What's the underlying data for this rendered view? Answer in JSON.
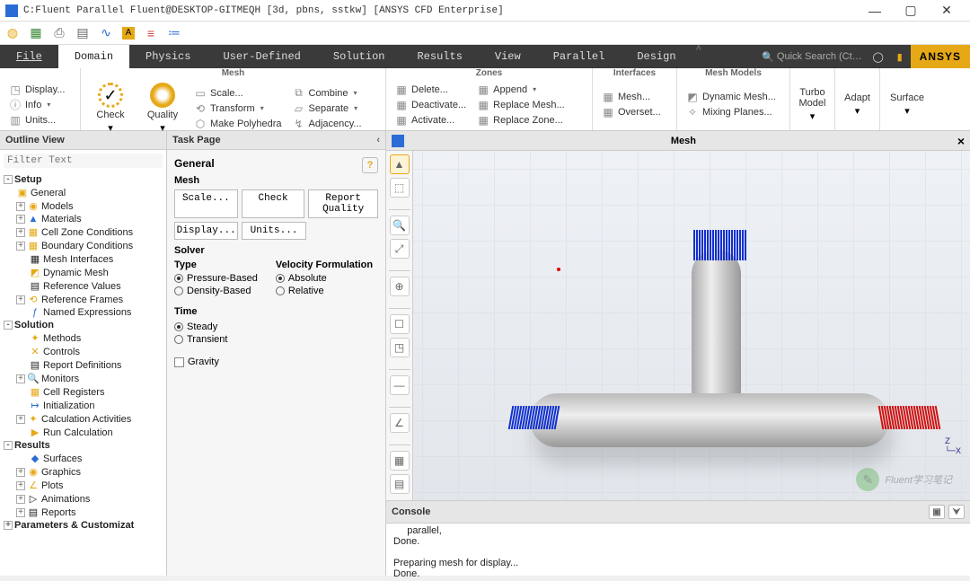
{
  "titlebar": {
    "title": "C:Fluent Parallel Fluent@DESKTOP-GITMEQH  [3d, pbns, sstkw] [ANSYS CFD Enterprise]"
  },
  "menubar": {
    "tabs": [
      "File",
      "Domain",
      "Physics",
      "User-Defined",
      "Solution",
      "Results",
      "View",
      "Parallel",
      "Design"
    ],
    "active": 1,
    "hint": "^",
    "search_placeholder": "Quick Search (Ct…",
    "brand": "ANSYS"
  },
  "ribbon": {
    "groups": {
      "g0": {
        "items": [
          "Display...",
          "Info",
          "Units..."
        ]
      },
      "mesh": {
        "label": "Mesh",
        "check": "Check",
        "quality": "Quality",
        "scale": "Scale...",
        "transform": "Transform",
        "poly": "Make Polyhedra",
        "combine": "Combine",
        "separate": "Separate",
        "adjacency": "Adjacency..."
      },
      "zones": {
        "label": "Zones",
        "delete": "Delete...",
        "deactivate": "Deactivate...",
        "activate": "Activate...",
        "append": "Append",
        "replace_mesh": "Replace Mesh...",
        "replace_zone": "Replace Zone..."
      },
      "interfaces": {
        "label": "Interfaces",
        "mesh": "Mesh...",
        "overset": "Overset..."
      },
      "models": {
        "label": "Mesh Models",
        "dynamic": "Dynamic Mesh...",
        "mixing": "Mixing Planes..."
      },
      "turbo": "Turbo Model",
      "adapt": "Adapt",
      "surface": "Surface"
    }
  },
  "outline": {
    "title": "Outline View",
    "filter": "Filter Text",
    "nodes": {
      "setup": "Setup",
      "general": "General",
      "models": "Models",
      "materials": "Materials",
      "cellzone": "Cell Zone Conditions",
      "boundary": "Boundary Conditions",
      "meshif": "Mesh Interfaces",
      "dynmesh": "Dynamic Mesh",
      "refvals": "Reference Values",
      "refframes": "Reference Frames",
      "namedexpr": "Named Expressions",
      "solution": "Solution",
      "methods": "Methods",
      "controls": "Controls",
      "reportdef": "Report Definitions",
      "monitors": "Monitors",
      "cellreg": "Cell Registers",
      "init": "Initialization",
      "calcact": "Calculation Activities",
      "runcalc": "Run Calculation",
      "results": "Results",
      "surfaces": "Surfaces",
      "graphics": "Graphics",
      "plots": "Plots",
      "animations": "Animations",
      "reports": "Reports",
      "params": "Parameters & Customizat"
    }
  },
  "task": {
    "title": "Task Page",
    "heading": "General",
    "mesh_label": "Mesh",
    "buttons": {
      "scale": "Scale...",
      "check": "Check",
      "report": "Report Quality",
      "display": "Display...",
      "units": "Units..."
    },
    "solver_label": "Solver",
    "type_label": "Type",
    "type_opts": [
      "Pressure-Based",
      "Density-Based"
    ],
    "vel_label": "Velocity Formulation",
    "vel_opts": [
      "Absolute",
      "Relative"
    ],
    "time_label": "Time",
    "time_opts": [
      "Steady",
      "Transient"
    ],
    "gravity": "Gravity"
  },
  "gfx": {
    "title": "Mesh",
    "triad": "Z\n└─X"
  },
  "console": {
    "title": "Console",
    "text": "     parallel,\nDone.\n\nPreparing mesh for display...\nDone."
  },
  "watermark": "Fluent学习笔记"
}
